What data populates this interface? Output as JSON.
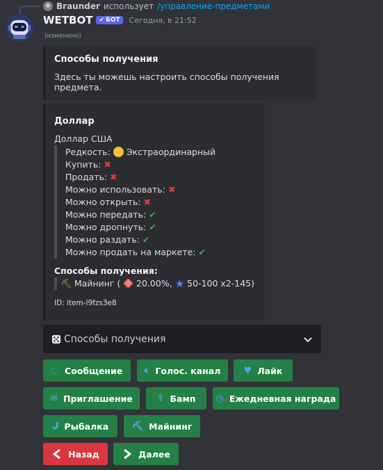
{
  "reply": {
    "user": "Braunder",
    "action": "использует",
    "command": "/управление-предметами"
  },
  "message": {
    "bot_name": "WETBOT",
    "bot_tag": "БОТ",
    "timestamp": "Сегодня, в 21:52",
    "edited": "(изменено)"
  },
  "embed1": {
    "title": "Способы получения",
    "description": "Здесь ты можешь настроить способы получения предмета."
  },
  "embed2": {
    "title": "Доллар",
    "subtitle": "Доллар США",
    "rarity_label": "Редкость:",
    "rarity_value": "Экстраординарный",
    "properties": [
      {
        "label": "Купить:",
        "value": "✖",
        "status": "no"
      },
      {
        "label": "Продать:",
        "value": "✖",
        "status": "no"
      },
      {
        "label": "Можно использовать:",
        "value": "✖",
        "status": "no"
      },
      {
        "label": "Можно открыть:",
        "value": "✖",
        "status": "no"
      },
      {
        "label": "Можно передать:",
        "value": "✔",
        "status": "yes"
      },
      {
        "label": "Можно дропнуть:",
        "value": "✔",
        "status": "yes"
      },
      {
        "label": "Можно раздать:",
        "value": "✔",
        "status": "yes"
      },
      {
        "label": "Можно продать на маркете:",
        "value": "✔",
        "status": "yes"
      }
    ],
    "ways_title": "Способы получения:",
    "way": {
      "icon": "⛏",
      "name": "Майнинг",
      "chance": "20.00%,",
      "amount": "50-100 x2-145)"
    },
    "footer": "ID: item-l9fzs3e8"
  },
  "select": {
    "icon": "dice-icon",
    "label": "Способы получения",
    "chevron": "⌄"
  },
  "buttons": {
    "message": "Сообщение",
    "voice": "Голос. канал",
    "like": "Лайк",
    "invite": "Приглашение",
    "bump": "Бамп",
    "daily": "Ежедневная награда",
    "fishing": "Рыбалка",
    "mining": "Майнинг",
    "back": "Назад",
    "next": "Далее"
  },
  "colors": {
    "green_button": "#248046",
    "red_button": "#da373c",
    "accent": "#5865f2",
    "background": "#313338",
    "embed": "#2b2d31"
  }
}
